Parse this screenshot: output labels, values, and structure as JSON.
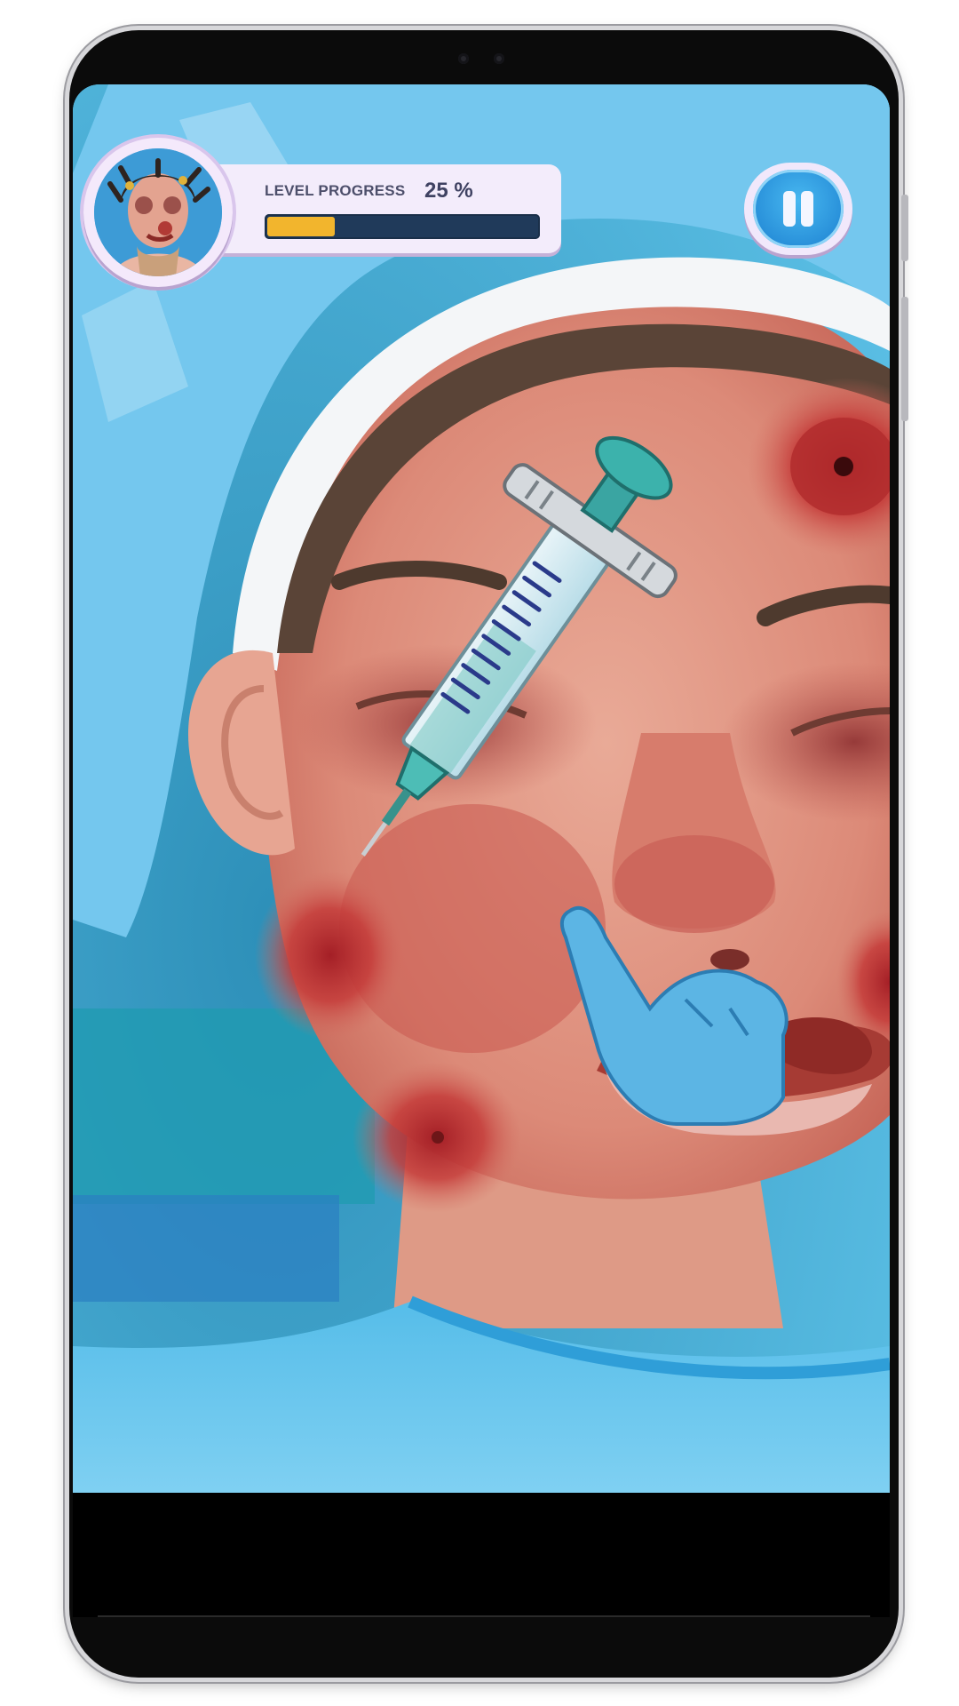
{
  "hud": {
    "avatar_icon": "patient-avatar-icon",
    "progress_label": "LEVEL PROGRESS",
    "progress_percent_text": "25 %",
    "progress_value": 0.25,
    "pause_icon": "pause-icon"
  },
  "colors": {
    "progress_fill": "#f2b52d",
    "progress_track": "#203a5a",
    "panel_bg": "#f3ecfb",
    "pause_button": "#2c9be2",
    "scrub_cap": "#72c8ef",
    "skin": "#e7a08e",
    "glove": "#5fb6e6"
  },
  "scene": {
    "tool_icon": "syringe-icon",
    "hint_icon": "pointing-hand-icon"
  }
}
